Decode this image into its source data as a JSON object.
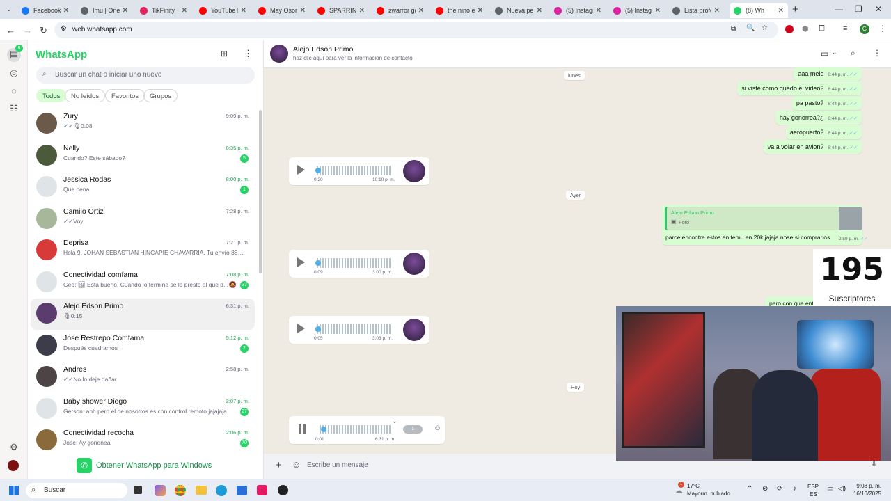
{
  "browser": {
    "tabs": [
      {
        "label": "Facebook",
        "color": "#1877f2"
      },
      {
        "label": "Imu | One",
        "color": "#5f6368"
      },
      {
        "label": "TikFinity",
        "color": "#e0245e"
      },
      {
        "label": "YouTube M",
        "color": "#ff0000"
      },
      {
        "label": "May Osori",
        "color": "#ff0000"
      },
      {
        "label": "SPARRING",
        "color": "#ff0000"
      },
      {
        "label": "zwarror gc",
        "color": "#ff0000"
      },
      {
        "label": "the nino e",
        "color": "#ff0000"
      },
      {
        "label": "Nueva pe",
        "color": "#5f6368"
      },
      {
        "label": "(5) Instagr",
        "color": "#d6249f"
      },
      {
        "label": "(5) Instagr",
        "color": "#d6249f"
      },
      {
        "label": "Lista profe",
        "color": "#5f6368"
      },
      {
        "label": "(8) Wh",
        "color": "#25d366"
      }
    ],
    "url": "web.whatsapp.com",
    "profile_initial": "G"
  },
  "rail": {
    "notification_count": "8"
  },
  "sidebar": {
    "title": "WhatsApp",
    "search_placeholder": "Buscar un chat o iniciar uno nuevo",
    "filters": [
      "Todos",
      "No leídos",
      "Favoritos",
      "Grupos"
    ],
    "chats": [
      {
        "name": "Zury",
        "preview": "✓✓🎙0:08",
        "time": "9:09 p. m.",
        "badge": "",
        "avatar": "#6b5a4a"
      },
      {
        "name": "Nelly",
        "preview": "Cuando? Este sábado?",
        "time": "8:35 p. m.",
        "badge": "5",
        "avatar": "#4a5a3a"
      },
      {
        "name": "Jessica Rodas",
        "preview": "Que pena",
        "time": "8:00 p. m.",
        "badge": "1",
        "avatar": "#dfe5e7"
      },
      {
        "name": "Camilo Ortiz",
        "preview": "✓✓Voy",
        "time": "7:28 p. m.",
        "badge": "",
        "avatar": "#a7b89a"
      },
      {
        "name": "Deprisa",
        "preview": "Hola 9. JOHAN SEBASTIAN HINCAPIE CHAVARRIA, Tu envío 8880012...",
        "time": "7:21 p. m.",
        "badge": "",
        "avatar": "#d83a3a"
      },
      {
        "name": "Conectividad comfama",
        "preview": "Geo: 🖼 Está bueno. Cuando lo termine se lo presto al que d...",
        "time": "7:08 p. m.",
        "badge": "37",
        "avatar": "#dfe5e7"
      },
      {
        "name": "Alejo Edson Primo",
        "preview": "🎙0:15",
        "time": "6:31 p. m.",
        "badge": "",
        "avatar": "#5a3d6e"
      },
      {
        "name": "Jose Restrepo Comfama",
        "preview": "Después cuadramos",
        "time": "5:12 p. m.",
        "badge": "2",
        "avatar": "#3c3c4a"
      },
      {
        "name": "Andres",
        "preview": "✓✓No lo deje dañar",
        "time": "2:58 p. m.",
        "badge": "",
        "avatar": "#4d4545"
      },
      {
        "name": "Baby shower Diego",
        "preview": "Gerson: ahh pero el de nosotros es con control remoto jajajaja",
        "time": "2:07 p. m.",
        "badge": "27",
        "avatar": "#dfe5e7"
      },
      {
        "name": "Conectividad recocha",
        "preview": "Jose: Ay gononea",
        "time": "2:06 p. m.",
        "badge": "70",
        "avatar": "#8a6a3a"
      }
    ],
    "get_windows": "Obtener WhatsApp para Windows"
  },
  "chat": {
    "contact_name": "Alejo Edson Primo",
    "contact_sub": "haz clic aquí para ver la información de contacto",
    "day_labels": [
      "lunes",
      "Ayer",
      "Hoy"
    ],
    "outgoing": [
      {
        "text": "aaa melo",
        "time": "8:44 p. m."
      },
      {
        "text": "si viste como quedo el video?",
        "time": "8:44 p. m."
      },
      {
        "text": "pa pasto?",
        "time": "8:44 p. m."
      },
      {
        "text": "hay gonorrea?¿",
        "time": "8:44 p. m."
      },
      {
        "text": "aeropuerto?",
        "time": "8:44 p. m."
      },
      {
        "text": "va a volar en avion?",
        "time": "8:44 p. m."
      }
    ],
    "reply": {
      "quoted_name": "Alejo Edson Primo",
      "quoted_text": "Foto",
      "text": "parce encontre estos en temu en 20k jajaja nose si comprarlos",
      "time": "2:59 p. m."
    },
    "partial_message": "pero con que ent",
    "audios": [
      {
        "duration": "0:20",
        "time": "10:10 p. m."
      },
      {
        "duration": "0:09",
        "time": "3:00 p. m."
      },
      {
        "duration": "0:05",
        "time": "3:03 p. m."
      }
    ],
    "playing_audio": {
      "position": "0:01",
      "time": "6:31 p. m.",
      "speed": "1"
    },
    "composer_placeholder": "Escribe un mensaje"
  },
  "overlay": {
    "subscribers": "195",
    "subscribers_label": "Suscriptores"
  },
  "taskbar": {
    "search": "Buscar",
    "weather_temp": "17°C",
    "weather_desc": "Mayorm. nublado",
    "lang": "ESP",
    "lang2": "ES",
    "time": "9:08 p. m.",
    "date": "16/10/2025",
    "weather_badge": "1"
  }
}
